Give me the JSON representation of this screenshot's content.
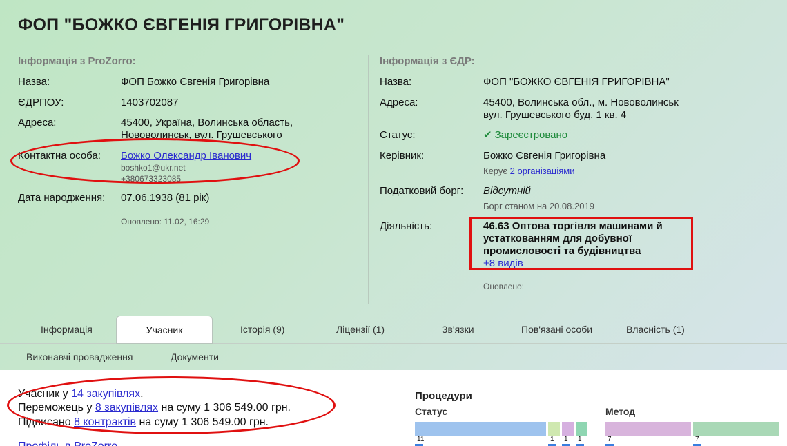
{
  "header": {
    "title": "ФОП \"БОЖКО ЄВГЕНІЯ ГРИГОРІВНА\""
  },
  "prozorro": {
    "heading": "Інформація з ProZorro:",
    "name_label": "Назва:",
    "name_value": "ФОП Божко Євгенія Григорівна",
    "edrpou_label": "ЄДРПОУ:",
    "edrpou_value": "1403702087",
    "address_label": "Адреса:",
    "address_line1": "45400, Україна, Волинська область,",
    "address_line2": "Нововолинськ, вул. Грушевського",
    "contact_label": "Контактна особа:",
    "contact_name": "Божко Олександр Іванович",
    "contact_email": "boshko1@ukr.net",
    "contact_phone": "+380673323085",
    "birth_label": "Дата народження:",
    "birth_value": "07.06.1938 (81 рік)",
    "updated": "Оновлено: 11.02, 16:29"
  },
  "edr": {
    "heading": "Інформація з ЄДР:",
    "name_label": "Назва:",
    "name_value": "ФОП \"БОЖКО ЄВГЕНІЯ ГРИГОРІВНА\"",
    "address_label": "Адреса:",
    "address_line1": "45400, Волинська обл., м. Нововолинськ",
    "address_line2": "вул. Грушевського буд. 1 кв. 4",
    "status_label": "Статус:",
    "status_value": "Зареєстровано",
    "manager_label": "Керівник:",
    "manager_value": "Божко Євгенія Григорівна",
    "manages_prefix": "Керує",
    "manages_link": "2 організаціями",
    "tax_label": "Податковий борг:",
    "tax_value": "Відсутній",
    "tax_note": "Борг станом на 20.08.2019",
    "activity_label": "Діяльність:",
    "activity_value": "46.63 Оптова торгівля машинами й устаткованням для добувної промисловості та будівництва",
    "activity_more": "+8 видів",
    "updated": "Оновлено:"
  },
  "tabs": [
    {
      "label": "Інформація"
    },
    {
      "label": "Учасник"
    },
    {
      "label": "Історія (9)"
    },
    {
      "label": "Ліцензії (1)"
    },
    {
      "label": "Зв'язки"
    },
    {
      "label": "Пов'язані особи"
    },
    {
      "label": "Власність (1)"
    },
    {
      "label": "Виконавчі провадження"
    },
    {
      "label": "Документи"
    }
  ],
  "summary": {
    "line1_prefix": "Учасник у",
    "line1_link": "14 закупівлях",
    "line1_suffix": ".",
    "line2_prefix": "Переможець у",
    "line2_link": "8 закупівлях",
    "line2_suffix": "на суму 1 306 549.00 грн.",
    "line3_prefix": "Підписано",
    "line3_link": "8 контрактів",
    "line3_suffix": "на суму 1 306 549.00 грн.",
    "cut_text": "Профіль в ProZorro"
  },
  "procedures": {
    "title": "Процедури",
    "status_label": "Статус",
    "method_label": "Метод"
  },
  "chart_data": [
    {
      "type": "bar",
      "title": "Статус",
      "values": [
        11,
        1,
        1,
        1
      ],
      "colors": [
        "#9ec3ee",
        "#cfe8b0",
        "#d6b0e0",
        "#8fd6b2"
      ]
    },
    {
      "type": "bar",
      "title": "Метод",
      "values": [
        7,
        7
      ],
      "colors": [
        "#d8b4dc",
        "#a9d8b6"
      ]
    }
  ]
}
